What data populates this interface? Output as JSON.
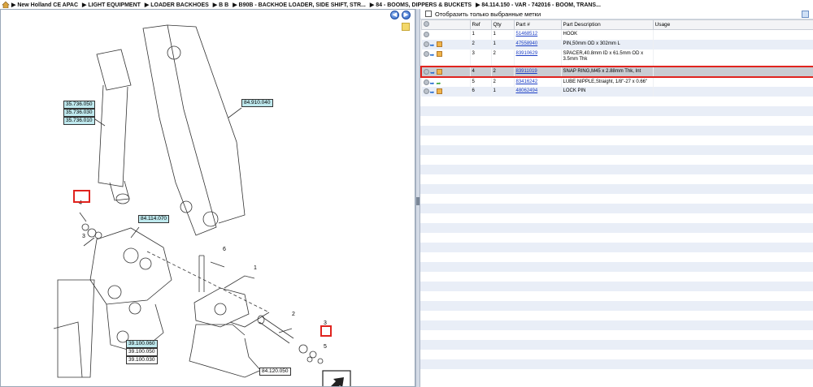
{
  "breadcrumb": [
    "New Holland CE APAC",
    "LIGHT EQUIPMENT",
    "LOADER BACKHOES",
    "B B",
    "B90B - BACKHOE LOADER, SIDE SHIFT, STR...",
    "84 - BOOMS, DIPPERS & BUCKETS",
    "84.114.150 - VAR - 742016 - BOOM, TRANS..."
  ],
  "nav": {
    "prev": "◀",
    "next": "▶"
  },
  "diagram": {
    "callouts": [
      "35.736.050",
      "35.736.030",
      "35.736.010",
      "84.910.040",
      "84.114.070",
      "39.100.060",
      "39.100.050",
      "39.100.030",
      "84.120.050"
    ],
    "numbers": [
      "1",
      "2",
      "3",
      "3",
      "4",
      "5",
      "6"
    ]
  },
  "filter": {
    "label": "Отобразить только выбранные метки"
  },
  "table": {
    "headers": [
      "Ref",
      "Qty",
      "Part #",
      "Part Description",
      "Usage"
    ],
    "rows": [
      {
        "ref": "1",
        "qty": "1",
        "part": "51468512",
        "desc": "HOOK",
        "usage": ""
      },
      {
        "ref": "2",
        "qty": "1",
        "part": "47558940",
        "desc": "PIN,50mm OD x 302mm L",
        "usage": ""
      },
      {
        "ref": "3",
        "qty": "2",
        "part": "83910629",
        "desc": "SPACER,40.8mm ID x 61.5mm OD x 3.5mm Thk",
        "usage": ""
      },
      {
        "ref": "4",
        "qty": "2",
        "part": "83911019",
        "desc": "SNAP RING,M45 x 2.88mm Thk, Int",
        "usage": ""
      },
      {
        "ref": "5",
        "qty": "2",
        "part": "83416242",
        "desc": "LUBE NIPPLE,Straight, 1/8\"-27 x 0.66\"",
        "usage": ""
      },
      {
        "ref": "6",
        "qty": "1",
        "part": "48062494",
        "desc": "LOCK PIN",
        "usage": ""
      }
    ]
  },
  "colors": {
    "highlight": "#e0231e",
    "callout_fill": "#bfe9ee",
    "link": "#1d3fc4"
  }
}
